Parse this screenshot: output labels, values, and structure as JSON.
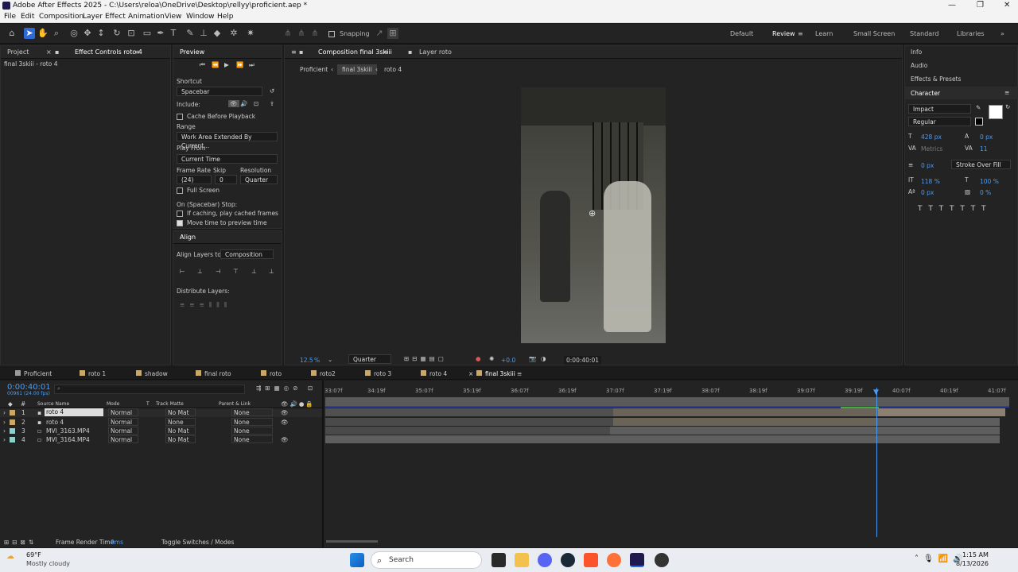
{
  "window": {
    "title": "Adobe After Effects 2025 - C:\\Users\\reloa\\OneDrive\\Desktop\\rellyy\\proficient.aep *"
  },
  "menu": [
    "File",
    "Edit",
    "Composition",
    "Layer",
    "Effect",
    "Animation",
    "View",
    "Window",
    "Help"
  ],
  "toolbar": {
    "snapping": "Snapping",
    "workspaces": [
      "Default",
      "Review",
      "Learn",
      "Small Screen",
      "Standard",
      "Libraries"
    ]
  },
  "left": {
    "tab_project": "Project",
    "tab_effect": "Effect Controls roto 4",
    "subtitle": "final 3skiii - roto 4"
  },
  "preview": {
    "title": "Preview",
    "shortcut_label": "Shortcut",
    "shortcut": "Spacebar",
    "include": "Include:",
    "cache": "Cache Before Playback",
    "range_label": "Range",
    "range": "Work Area Extended By Current...",
    "playfrom_label": "Play From",
    "playfrom": "Current Time",
    "fr_label": "Frame Rate",
    "skip_label": "Skip",
    "res_label": "Resolution",
    "fr": "(24)",
    "skip": "0",
    "res": "Quarter",
    "fullscreen": "Full Screen",
    "stop_label": "On (Spacebar) Stop:",
    "if_caching": "If caching, play cached frames",
    "move_time": "Move time to preview time"
  },
  "align": {
    "title": "Align",
    "align_to_label": "Align Layers to:",
    "align_to": "Composition",
    "distribute": "Distribute Layers:"
  },
  "comp": {
    "tab": "Composition final 3skiii",
    "layer_tab": "Layer roto",
    "crumbs": [
      "Proficient",
      "final 3skiii",
      "roto 4"
    ],
    "zoom": "12.5",
    "zoom_unit": "%",
    "resolution": "Quarter",
    "exposure": "+0.0",
    "timecode": "0:00:40:01"
  },
  "right": {
    "info": "Info",
    "audio": "Audio",
    "effects": "Effects & Presets",
    "character": "Character",
    "font": "Impact",
    "style": "Regular",
    "size": "428 px",
    "leading": "0 px",
    "kerning": "Metrics",
    "tracking": "11",
    "stroke_w": "0 px",
    "stroke_mode": "Stroke Over Fill",
    "vscale": "118 %",
    "hscale": "100 %",
    "baseline": "0 px",
    "tsume": "0 %",
    "fill_color": "#ffffff"
  },
  "timeline": {
    "tabs": [
      "Proficient",
      "roto 1",
      "shadow",
      "final roto",
      "roto",
      "roto2",
      "roto 3",
      "roto 4",
      "final 3skiii"
    ],
    "tab_colors": [
      "#9b9b9b",
      "#c9a86a",
      "#c9a86a",
      "#c9a86a",
      "#c9a86a",
      "#c9a86a",
      "#c9a86a",
      "#c9a86a",
      "#c9a86a"
    ],
    "time": "0:00:40:01",
    "frames": "00961 (24.00 fps)",
    "cols": {
      "source": "Source Name",
      "mode": "Mode",
      "t": "T",
      "matte": "Track Matte",
      "parent": "Parent & Link"
    },
    "layers": [
      {
        "num": "1",
        "name": "roto 4",
        "mode": "Normal",
        "matte": "No Mat",
        "parent": "None",
        "color": "#c9a86a"
      },
      {
        "num": "2",
        "name": "roto 4",
        "mode": "Normal",
        "matte": "None",
        "parent": "None",
        "color": "#c9a86a"
      },
      {
        "num": "3",
        "name": "MVI_3163.MP4",
        "mode": "Normal",
        "matte": "No Mat",
        "parent": "None",
        "color": "#8fd0cf"
      },
      {
        "num": "4",
        "name": "MVI_3164.MP4",
        "mode": "Normal",
        "matte": "No Mat",
        "parent": "None",
        "color": "#8fd0cf"
      }
    ],
    "ticks": [
      "33:07f",
      "34:19f",
      "35:07f",
      "35:19f",
      "36:07f",
      "36:19f",
      "37:07f",
      "37:19f",
      "38:07f",
      "38:19f",
      "39:07f",
      "39:19f",
      "40:07f",
      "40:19f",
      "41:07f"
    ],
    "render_label": "Frame Render Time:",
    "render_val": "0ms",
    "toggle": "Toggle Switches / Modes"
  },
  "taskbar": {
    "temp": "69°F",
    "weather": "Mostly cloudy",
    "search": "Search",
    "time": "1:15 AM",
    "date": "8/13/2026"
  }
}
